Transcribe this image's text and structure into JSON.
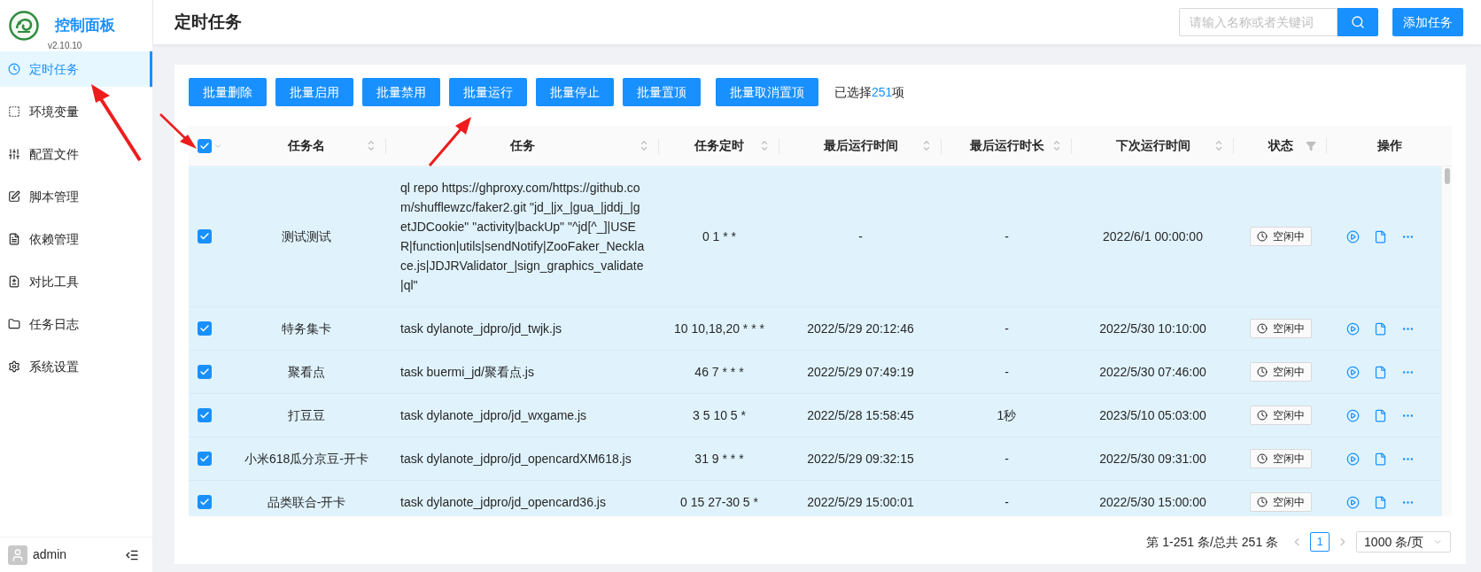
{
  "app": {
    "title": "控制面板",
    "version": "v2.10.10"
  },
  "sidebar": {
    "items": [
      {
        "label": "定时任务",
        "selected": true
      },
      {
        "label": "环境变量",
        "selected": false
      },
      {
        "label": "配置文件",
        "selected": false
      },
      {
        "label": "脚本管理",
        "selected": false
      },
      {
        "label": "依赖管理",
        "selected": false
      },
      {
        "label": "对比工具",
        "selected": false
      },
      {
        "label": "任务日志",
        "selected": false
      },
      {
        "label": "系统设置",
        "selected": false
      }
    ],
    "user": "admin"
  },
  "header": {
    "title": "定时任务",
    "search": {
      "placeholder": "请输入名称或者关键词"
    },
    "add_button": "添加任务"
  },
  "toolbar": {
    "buttons": [
      "批量删除",
      "批量启用",
      "批量禁用",
      "批量运行",
      "批量停止",
      "批量置顶",
      "批量取消置顶"
    ],
    "selection": {
      "prefix": "已选择",
      "count": "251",
      "suffix": "项"
    }
  },
  "table": {
    "select_all_checked": true,
    "columns": [
      {
        "label": "任务名",
        "kind": "sortable"
      },
      {
        "label": "任务",
        "kind": "sortable"
      },
      {
        "label": "任务定时",
        "kind": "sortable"
      },
      {
        "label": "最后运行时间",
        "kind": "sortable"
      },
      {
        "label": "最后运行时长",
        "kind": "sortable"
      },
      {
        "label": "下次运行时间",
        "kind": "sortable"
      },
      {
        "label": "状态",
        "kind": "filterable"
      },
      {
        "label": "操作",
        "kind": "plain"
      }
    ],
    "rows": [
      {
        "checked": true,
        "name": "测试测试",
        "command": "ql repo https://ghproxy.com/https://github.com/shufflewzc/faker2.git \"jd_|jx_|gua_|jddj_|getJDCookie\" \"activity|backUp\" \"^jd[^_]|USER|function|utils|sendNotify|ZooFaker_Necklace.js|JDJRValidator_|sign_graphics_validate|ql\"",
        "schedule": "0 1 * *",
        "last_run": "-",
        "duration": "-",
        "next_run": "2022/6/1 00:00:00",
        "status": "空闲中"
      },
      {
        "checked": true,
        "name": "特务集卡",
        "command": "task dylanote_jdpro/jd_twjk.js",
        "schedule": "10 10,18,20 * * *",
        "last_run": "2022/5/29 20:12:46",
        "duration": "-",
        "next_run": "2022/5/30 10:10:00",
        "status": "空闲中"
      },
      {
        "checked": true,
        "name": "聚看点",
        "command": "task buermi_jd/聚看点.js",
        "schedule": "46 7 * * *",
        "last_run": "2022/5/29 07:49:19",
        "duration": "-",
        "next_run": "2022/5/30 07:46:00",
        "status": "空闲中"
      },
      {
        "checked": true,
        "name": "打豆豆",
        "command": "task dylanote_jdpro/jd_wxgame.js",
        "schedule": "3 5 10 5 *",
        "last_run": "2022/5/28 15:58:45",
        "duration": "1秒",
        "next_run": "2023/5/10 05:03:00",
        "status": "空闲中"
      },
      {
        "checked": true,
        "name": "小米618瓜分京豆-开卡",
        "command": "task dylanote_jdpro/jd_opencardXM618.js",
        "schedule": "31 9 * * *",
        "last_run": "2022/5/29 09:32:15",
        "duration": "-",
        "next_run": "2022/5/30 09:31:00",
        "status": "空闲中"
      },
      {
        "checked": true,
        "name": "品类联合-开卡",
        "command": "task dylanote_jdpro/jd_opencard36.js",
        "schedule": "0 15 27-30 5 *",
        "last_run": "2022/5/29 15:00:01",
        "duration": "-",
        "next_run": "2022/5/30 15:00:00",
        "status": "空闲中"
      }
    ]
  },
  "pagination": {
    "summary": "第 1-251 条/总共 251 条",
    "pages": [
      {
        "label": "1",
        "selected": true
      }
    ],
    "page_size": "1000 条/页"
  }
}
